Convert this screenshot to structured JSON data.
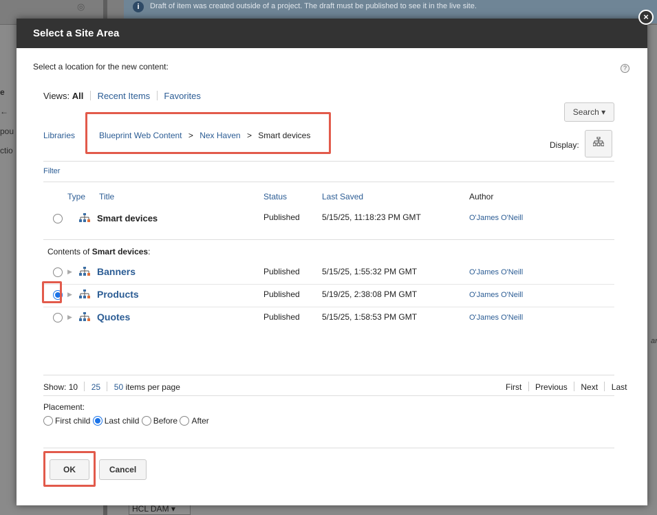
{
  "background": {
    "info_banner": "Draft of item was created outside of a project. The draft must be published to see it in the live site.",
    "left_fragments": [
      "e",
      "←",
      "pou",
      "ctio"
    ],
    "right_fragment": "are",
    "bottom_select": "HCL DAM ▾"
  },
  "dialog": {
    "title": "Select a Site Area",
    "prompt": "Select a location for the new content:",
    "help": "?",
    "close": "×",
    "views": {
      "label": "Views:",
      "all": "All",
      "recent": "Recent Items",
      "favorites": "Favorites"
    },
    "search_label": "Search ▾",
    "display_label": "Display:",
    "breadcrumb": {
      "root": "Libraries",
      "items": [
        "Blueprint Web Content",
        "Nex Haven",
        "Smart devices"
      ],
      "separator": ">"
    },
    "filter_label": "Filter",
    "columns": {
      "type": "Type",
      "title": "Title",
      "status": "Status",
      "last_saved": "Last Saved",
      "author": "Author"
    },
    "current": {
      "title": "Smart devices",
      "status": "Published",
      "last_saved": "5/15/25, 11:18:23 PM GMT",
      "author": "O'James O'Neill"
    },
    "contents_prefix": "Contents of ",
    "contents_name": "Smart devices",
    "contents_suffix": ":",
    "rows": [
      {
        "title": "Banners",
        "status": "Published",
        "last_saved": "5/15/25, 1:55:32 PM GMT",
        "author": "O'James O'Neill",
        "selected": false
      },
      {
        "title": "Products",
        "status": "Published",
        "last_saved": "5/19/25, 2:38:08 PM GMT",
        "author": "O'James O'Neill",
        "selected": true
      },
      {
        "title": "Quotes",
        "status": "Published",
        "last_saved": "5/15/25, 1:58:53 PM GMT",
        "author": "O'James O'Neill",
        "selected": false
      }
    ],
    "pager": {
      "show_label": "Show:",
      "sizes": [
        "10",
        "25",
        "50"
      ],
      "items_per_page": "items per page",
      "first": "First",
      "previous": "Previous",
      "next": "Next",
      "last": "Last"
    },
    "placement": {
      "label": "Placement:",
      "options": [
        "First child",
        "Last child",
        "Before",
        "After"
      ],
      "selected": "Last child"
    },
    "ok_label": "OK",
    "cancel_label": "Cancel"
  },
  "colors": {
    "header_bg": "#333333",
    "link": "#2b5c94",
    "highlight": "#e25a4b",
    "radio_checked": "#1a73e8"
  }
}
